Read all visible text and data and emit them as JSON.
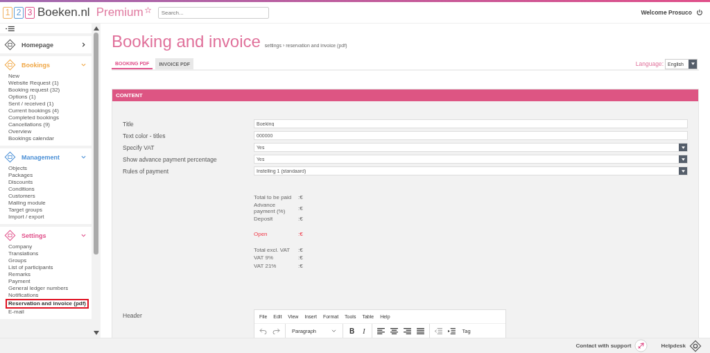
{
  "header": {
    "logo_digits": [
      {
        "text": "1",
        "color": "#f0b060"
      },
      {
        "text": "2",
        "color": "#5b9bd5"
      },
      {
        "text": "3",
        "color": "#e0508a"
      }
    ],
    "logo_text": "Boeken.nl",
    "edition": "Premium",
    "search": {
      "placeholder": "Search..."
    },
    "welcome": "Welcome Prosuco"
  },
  "sidebar": {
    "sections": [
      {
        "title": "Homepage",
        "color": "#555555",
        "expanded": false
      },
      {
        "title": "Bookings",
        "color": "#f0a848",
        "expanded": true,
        "items": [
          {
            "label": "New",
            "selected": false
          },
          {
            "label": "Website Request (1)",
            "selected": false
          },
          {
            "label": "Booking request (32)",
            "selected": false
          },
          {
            "label": "Options (1)",
            "selected": false
          },
          {
            "label": "Sent / received (1)",
            "selected": false
          },
          {
            "label": "Current bookings (4)",
            "selected": false
          },
          {
            "label": "Completed bookings",
            "selected": false
          },
          {
            "label": "Cancellations (9)",
            "selected": false
          },
          {
            "label": "Overview",
            "selected": false
          },
          {
            "label": "Bookings calendar",
            "selected": false
          }
        ]
      },
      {
        "title": "Management",
        "color": "#4a8fd6",
        "expanded": true,
        "items": [
          {
            "label": "Objects",
            "selected": false
          },
          {
            "label": "Packages",
            "selected": false
          },
          {
            "label": "Discounts",
            "selected": false
          },
          {
            "label": "Conditions",
            "selected": false
          },
          {
            "label": "Customers",
            "selected": false
          },
          {
            "label": "Mailing module",
            "selected": false
          },
          {
            "label": "Target groups",
            "selected": false
          },
          {
            "label": "Import / export",
            "selected": false
          }
        ]
      },
      {
        "title": "Settings",
        "color": "#e0508a",
        "expanded": true,
        "items": [
          {
            "label": "Company",
            "selected": false
          },
          {
            "label": "Translations",
            "selected": false
          },
          {
            "label": "Groups",
            "selected": false
          },
          {
            "label": "List of participants",
            "selected": false
          },
          {
            "label": "Remarks",
            "selected": false
          },
          {
            "label": "Payment",
            "selected": false
          },
          {
            "label": "General ledger numbers",
            "selected": false
          },
          {
            "label": "Notifications",
            "selected": false
          },
          {
            "label": "Reservation and invoice (pdf)",
            "selected": true
          },
          {
            "label": "E-mail",
            "selected": false
          }
        ]
      }
    ]
  },
  "page": {
    "title": "Booking and invoice",
    "breadcrumb": "settings › reservation and invoice (pdf)",
    "tabs": [
      {
        "label": "BOOKING PDF",
        "selected": true
      },
      {
        "label": "INVOICE PDF",
        "selected": false
      }
    ],
    "language": {
      "label": "Language:",
      "value": "English"
    }
  },
  "panel": {
    "title": "CONTENT",
    "fields": [
      {
        "label": "Title",
        "kind": "text",
        "value": "Boeking"
      },
      {
        "label": "Text color - titles",
        "kind": "text",
        "value": "000000"
      },
      {
        "label": "Specify VAT",
        "kind": "select",
        "value": "Yes"
      },
      {
        "label": "Show advance payment percentage",
        "kind": "select",
        "value": "Yes"
      },
      {
        "label": "Rules of payment",
        "kind": "select",
        "value": "Instelling 1 (standaard)"
      }
    ],
    "totals": [
      [
        {
          "label": "Total to be paid",
          "value": ":€",
          "alert": false
        },
        {
          "label": "Advance payment (%)",
          "value": ":€",
          "alert": false
        },
        {
          "label": "Deposit",
          "value": ":€",
          "alert": false
        }
      ],
      [
        {
          "label": "Open",
          "value": ":€",
          "alert": true
        }
      ],
      [
        {
          "label": "Total excl. VAT",
          "value": ":€",
          "alert": false
        },
        {
          "label": "VAT 9%",
          "value": ":€",
          "alert": false
        },
        {
          "label": "VAT 21%",
          "value": ":€",
          "alert": false
        }
      ]
    ],
    "editor": {
      "label": "Header",
      "menu": [
        "File",
        "Edit",
        "View",
        "Insert",
        "Format",
        "Tools",
        "Table",
        "Help"
      ],
      "block_format": "Paragraph",
      "bold": "B",
      "italic": "I",
      "tag": "Tag"
    }
  },
  "footer": {
    "support": "Contact with support",
    "helpdesk": "Helpdesk"
  }
}
